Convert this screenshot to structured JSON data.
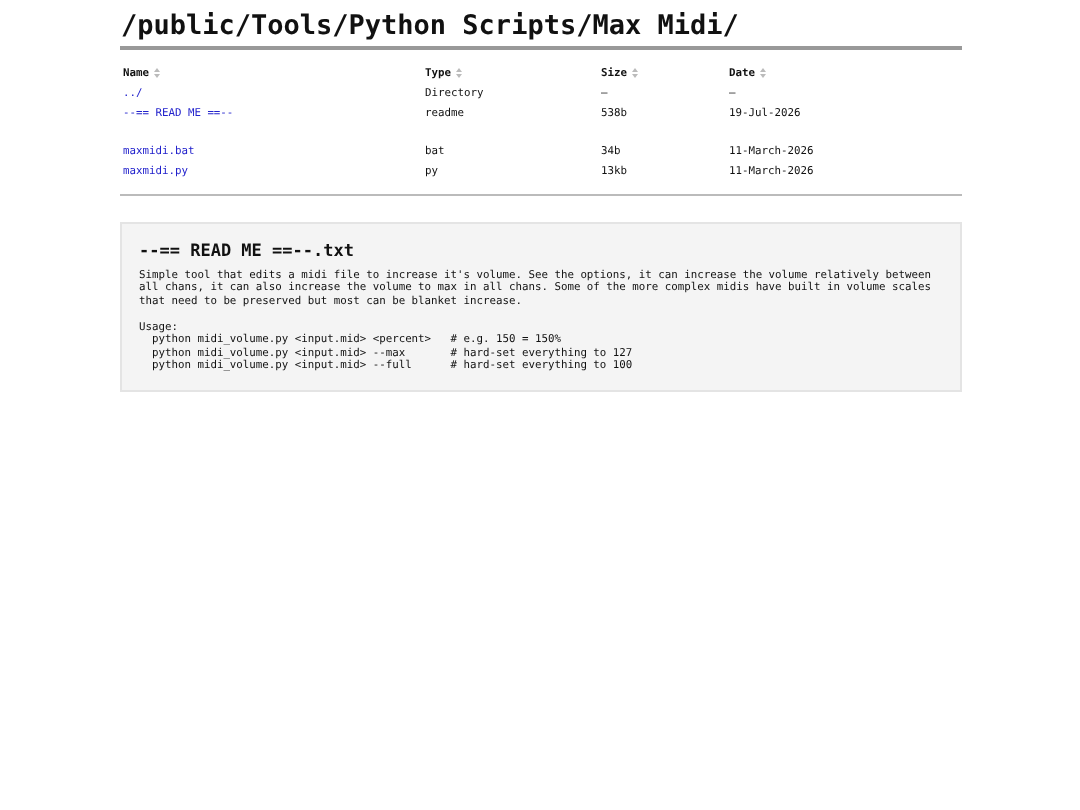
{
  "title": "/public/Tools/Python Scripts/Max Midi/",
  "table": {
    "columns": [
      "Name",
      "Type",
      "Size",
      "Date"
    ],
    "rows": [
      {
        "kind": "entry",
        "name": "../",
        "type": "Directory",
        "size": "—",
        "date": "—"
      },
      {
        "kind": "entry",
        "name": "--== READ ME ==--",
        "type": "readme",
        "size": "538b",
        "date": "19-Jul-2026"
      },
      {
        "kind": "spacer"
      },
      {
        "kind": "entry",
        "name": "maxmidi.bat",
        "type": "bat",
        "size": "34b",
        "date": "11-March-2026"
      },
      {
        "kind": "entry",
        "name": "maxmidi.py",
        "type": "py",
        "size": "13kb",
        "date": "11-March-2026"
      }
    ]
  },
  "readme": {
    "title": "--== READ ME ==--.txt",
    "description": "Simple tool that edits a midi file to increase it's volume. See the options, it can increase the volume relatively between all chans, it can also increase the volume to max in all chans. Some of the more complex midis have built in volume scales that need to be preserved but most can be blanket increase.",
    "usage_label": "Usage:",
    "usage_lines": [
      "  python midi_volume.py <input.mid> <percent>   # e.g. 150 = 150%",
      "  python midi_volume.py <input.mid> --max       # hard-set everything to 127",
      "  python midi_volume.py <input.mid> --full      # hard-set everything to 100"
    ]
  }
}
